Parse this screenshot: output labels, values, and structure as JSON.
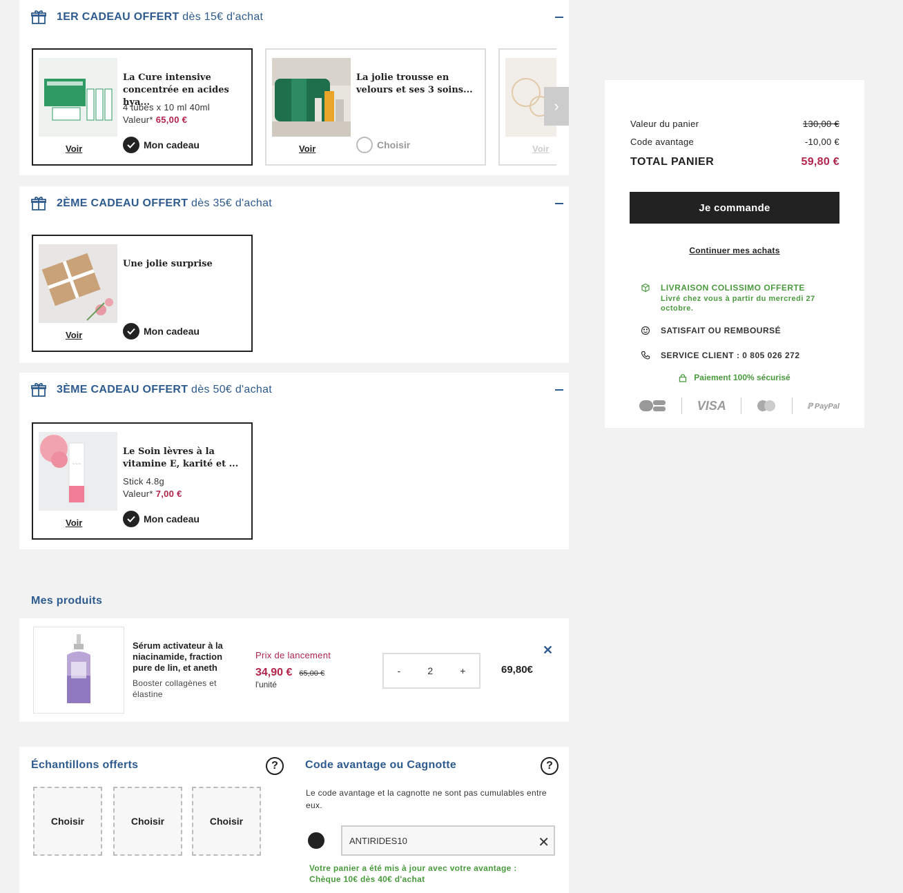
{
  "gift_sections": [
    {
      "title_bold": "1ER CADEAU OFFERT",
      "title_rest": " dès 15€ d'achat",
      "cards": [
        {
          "name": "La Cure intensive concentrée en acides hya...",
          "qty": "4 tubes x 10 ml 40ml",
          "value_label": "Valeur* ",
          "value": "65,00 €",
          "voir": "Voir",
          "pick": "Mon cadeau"
        },
        {
          "name": "La jolie trousse en velours et ses 3 soins...",
          "voir": "Voir",
          "pick": "Choisir"
        },
        {
          "voir": "Voir"
        }
      ]
    },
    {
      "title_bold": "2ÈME CADEAU OFFERT",
      "title_rest": " dès 35€ d'achat",
      "cards": [
        {
          "name": "Une jolie surprise",
          "voir": "Voir",
          "pick": "Mon cadeau"
        }
      ]
    },
    {
      "title_bold": "3ÈME CADEAU OFFERT",
      "title_rest": " dès 50€ d'achat",
      "cards": [
        {
          "name": "Le Soin lèvres à la vitamine E, karité et ...",
          "qty": "Stick 4.8g",
          "value_label": "Valeur* ",
          "value": "7,00 €",
          "voir": "Voir",
          "pick": "Mon cadeau"
        }
      ]
    }
  ],
  "summary": {
    "cart_value_label": "Valeur du panier",
    "cart_value": "130,00 €",
    "code_label": "Code avantage",
    "code_value": "-10,00 €",
    "total_label": "TOTAL PANIER",
    "total_value": "59,80 €",
    "cta": "Je commande",
    "continue": "Continuer mes achats",
    "delivery_title": "LIVRAISON COLISSIMO OFFERTE",
    "delivery_sub": "Livré chez vous à partir du mercredi 27 octobre.",
    "satisfait": "SATISFAIT OU REMBOURSÉ",
    "service": "SERVICE CLIENT : 0 805 026 272",
    "secure": "Paiement 100% sécurisé",
    "visa": "VISA",
    "paypal": "PayPal"
  },
  "products": {
    "title": "Mes produits",
    "items": [
      {
        "name": "Sérum activateur à la niacinamide, fraction pure de lin, et aneth",
        "sub": "Booster collagènes et élastine",
        "launch": "Prix de lancement",
        "price": "34,90 €",
        "old_price": "65,00 €",
        "unit": "l'unité",
        "minus": "-",
        "qty": "2",
        "plus": "+",
        "total": "69,80€"
      }
    ]
  },
  "samples": {
    "title": "Échantillons offerts",
    "items": [
      "Choisir",
      "Choisir",
      "Choisir"
    ]
  },
  "code": {
    "title": "Code avantage ou Cagnotte",
    "desc": "Le code avantage et la cagnotte ne sont pas cumulables entre eux.",
    "value": "ANTIRIDES10",
    "msg1": "Votre panier a été mis à jour avec votre avantage :",
    "msg2": "Chèque 10€ dès 40€ d'achat"
  },
  "colors": {
    "accent": "#2e5b8f",
    "price": "#b3244a",
    "success": "#4a9a3e",
    "dark": "#222222"
  }
}
